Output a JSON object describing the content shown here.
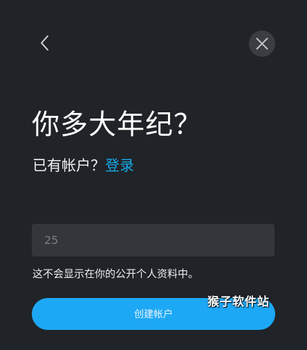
{
  "header": {
    "back_icon": "chevron-left-icon",
    "close_icon": "close-icon"
  },
  "title": "你多大年纪？",
  "subtitle": {
    "prefix": "已有帐户？",
    "login_link": "登录"
  },
  "age_field": {
    "placeholder": "25",
    "value": ""
  },
  "hint": "这不会显示在你的公开个人资料中。",
  "create_button": "创建帐户",
  "watermark": "猴子软件站",
  "colors": {
    "background": "#202327",
    "accent": "#1da8f5",
    "link": "#17a8e6",
    "input_bg": "#33363a",
    "close_bg": "#3a3d42"
  }
}
